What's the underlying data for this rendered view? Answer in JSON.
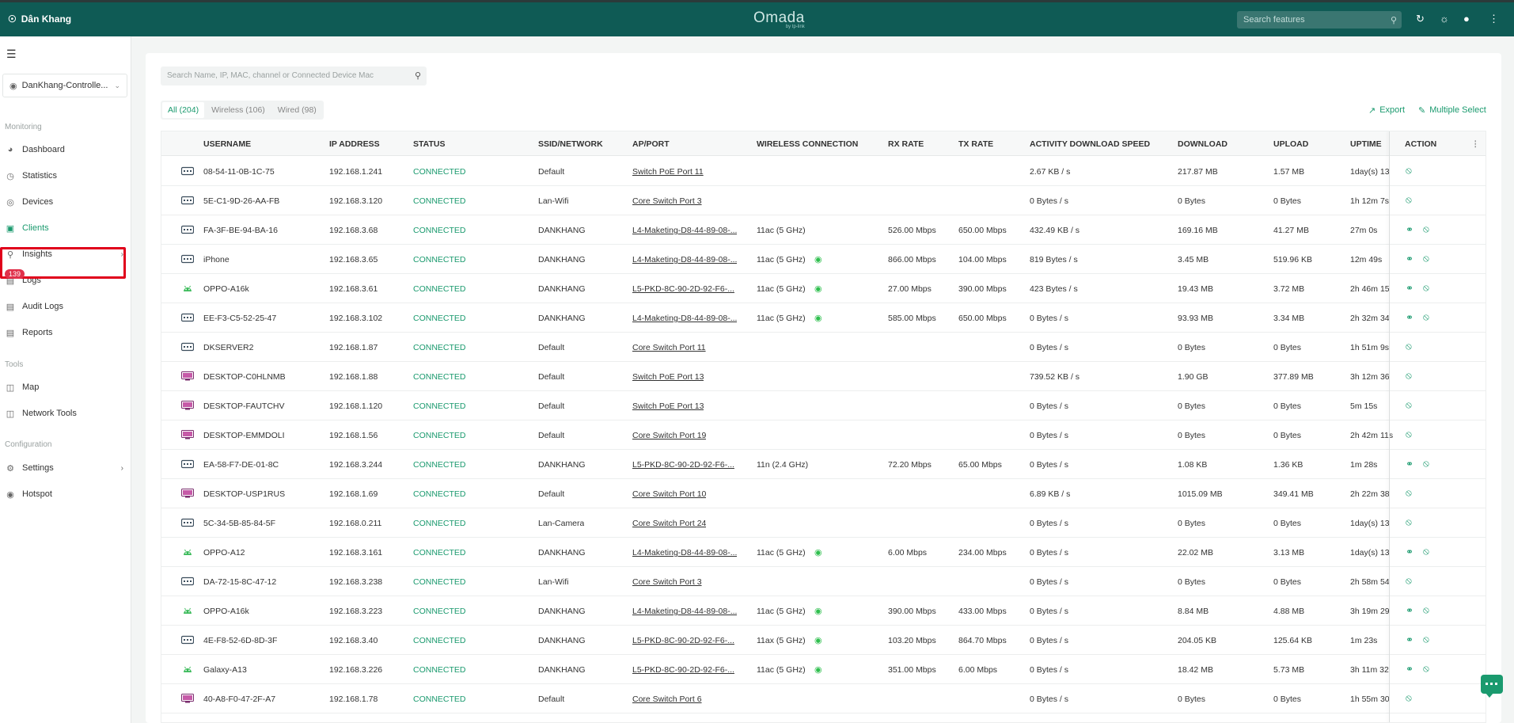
{
  "topbar": {
    "site_name": "Dân Khang",
    "logo_name": "Omada",
    "logo_sub": "by tp-link",
    "search_placeholder": "Search features"
  },
  "sidebar": {
    "site_select": "DanKhang-Controlle...",
    "sections": {
      "monitoring": "Monitoring",
      "tools": "Tools",
      "configuration": "Configuration"
    },
    "items": [
      {
        "label": "Dashboard"
      },
      {
        "label": "Statistics"
      },
      {
        "label": "Devices"
      },
      {
        "label": "Clients"
      },
      {
        "label": "Insights"
      },
      {
        "label": "Logs"
      },
      {
        "label": "Audit Logs"
      },
      {
        "label": "Reports"
      },
      {
        "label": "Map"
      },
      {
        "label": "Network Tools"
      },
      {
        "label": "Settings"
      },
      {
        "label": "Hotspot"
      }
    ],
    "logs_badge": "139"
  },
  "toolbar": {
    "search_placeholder": "Search Name, IP, MAC, channel or Connected Device Mac",
    "filters": [
      "All (204)",
      "Wireless (106)",
      "Wired (98)"
    ],
    "export_label": "Export",
    "multiple_select_label": "Multiple Select"
  },
  "table": {
    "headers": [
      "USERNAME",
      "IP ADDRESS",
      "STATUS",
      "SSID/NETWORK",
      "AP/PORT",
      "WIRELESS CONNECTION",
      "RX RATE",
      "TX RATE",
      "ACTIVITY DOWNLOAD SPEED",
      "DOWNLOAD",
      "UPLOAD",
      "UPTIME",
      "ACTION"
    ],
    "rows": [
      {
        "type": "wired",
        "name": "08-54-11-0B-1C-75",
        "ip": "192.168.1.241",
        "status": "CONNECTED",
        "ssid": "Default",
        "port": "Switch PoE Port 11",
        "wireless": "",
        "rx": "",
        "tx": "",
        "activity": "2.67 KB / s",
        "down": "217.87 MB",
        "up": "1.57 MB",
        "uptime": "1day(s) 13",
        "wifi": false
      },
      {
        "type": "wired",
        "name": "5E-C1-9D-26-AA-FB",
        "ip": "192.168.3.120",
        "status": "CONNECTED",
        "ssid": "Lan-Wifi",
        "port": "Core Switch Port 3",
        "wireless": "",
        "rx": "",
        "tx": "",
        "activity": "0 Bytes / s",
        "down": "0 Bytes",
        "up": "0 Bytes",
        "uptime": "1h 12m 7s",
        "wifi": false
      },
      {
        "type": "wired",
        "name": "FA-3F-BE-94-BA-16",
        "ip": "192.168.3.68",
        "status": "CONNECTED",
        "ssid": "DANKHANG",
        "port": "L4-Maketing-D8-44-89-08-...",
        "wireless": "11ac (5 GHz)",
        "rx": "526.00 Mbps",
        "tx": "650.00 Mbps",
        "activity": "432.49 KB / s",
        "down": "169.16 MB",
        "up": "41.27 MB",
        "uptime": "27m 0s",
        "wifi": true,
        "bulb": false
      },
      {
        "type": "wired",
        "name": "iPhone",
        "ip": "192.168.3.65",
        "status": "CONNECTED",
        "ssid": "DANKHANG",
        "port": "L4-Maketing-D8-44-89-08-...",
        "wireless": "11ac (5 GHz)",
        "rx": "866.00 Mbps",
        "tx": "104.00 Mbps",
        "activity": "819 Bytes / s",
        "down": "3.45 MB",
        "up": "519.96 KB",
        "uptime": "12m 49s",
        "wifi": true,
        "bulb": true
      },
      {
        "type": "android",
        "name": "OPPO-A16k",
        "ip": "192.168.3.61",
        "status": "CONNECTED",
        "ssid": "DANKHANG",
        "port": "L5-PKD-8C-90-2D-92-F6-...",
        "wireless": "11ac (5 GHz)",
        "rx": "27.00 Mbps",
        "tx": "390.00 Mbps",
        "activity": "423 Bytes / s",
        "down": "19.43 MB",
        "up": "3.72 MB",
        "uptime": "2h 46m 15",
        "wifi": true,
        "bulb": true
      },
      {
        "type": "wired",
        "name": "EE-F3-C5-52-25-47",
        "ip": "192.168.3.102",
        "status": "CONNECTED",
        "ssid": "DANKHANG",
        "port": "L4-Maketing-D8-44-89-08-...",
        "wireless": "11ac (5 GHz)",
        "rx": "585.00 Mbps",
        "tx": "650.00 Mbps",
        "activity": "0 Bytes / s",
        "down": "93.93 MB",
        "up": "3.34 MB",
        "uptime": "2h 32m 34",
        "wifi": true,
        "bulb": true
      },
      {
        "type": "wired",
        "name": "DKSERVER2",
        "ip": "192.168.1.87",
        "status": "CONNECTED",
        "ssid": "Default",
        "port": "Core Switch Port 11",
        "wireless": "",
        "rx": "",
        "tx": "",
        "activity": "0 Bytes / s",
        "down": "0 Bytes",
        "up": "0 Bytes",
        "uptime": "1h 51m 9s",
        "wifi": false
      },
      {
        "type": "desktop",
        "name": "DESKTOP-C0HLNMB",
        "ip": "192.168.1.88",
        "status": "CONNECTED",
        "ssid": "Default",
        "port": "Switch PoE Port 13",
        "wireless": "",
        "rx": "",
        "tx": "",
        "activity": "739.52 KB / s",
        "down": "1.90 GB",
        "up": "377.89 MB",
        "uptime": "3h 12m 36",
        "wifi": false
      },
      {
        "type": "desktop",
        "name": "DESKTOP-FAUTCHV",
        "ip": "192.168.1.120",
        "status": "CONNECTED",
        "ssid": "Default",
        "port": "Switch PoE Port 13",
        "wireless": "",
        "rx": "",
        "tx": "",
        "activity": "0 Bytes / s",
        "down": "0 Bytes",
        "up": "0 Bytes",
        "uptime": "5m 15s",
        "wifi": false
      },
      {
        "type": "desktop",
        "name": "DESKTOP-EMMDOLI",
        "ip": "192.168.1.56",
        "status": "CONNECTED",
        "ssid": "Default",
        "port": "Core Switch Port 19",
        "wireless": "",
        "rx": "",
        "tx": "",
        "activity": "0 Bytes / s",
        "down": "0 Bytes",
        "up": "0 Bytes",
        "uptime": "2h 42m 11s",
        "wifi": false
      },
      {
        "type": "wired",
        "name": "EA-58-F7-DE-01-8C",
        "ip": "192.168.3.244",
        "status": "CONNECTED",
        "ssid": "DANKHANG",
        "port": "L5-PKD-8C-90-2D-92-F6-...",
        "wireless": "11n (2.4 GHz)",
        "rx": "72.20 Mbps",
        "tx": "65.00 Mbps",
        "activity": "0 Bytes / s",
        "down": "1.08 KB",
        "up": "1.36 KB",
        "uptime": "1m 28s",
        "wifi": true,
        "bulb": false
      },
      {
        "type": "desktop",
        "name": "DESKTOP-USP1RUS",
        "ip": "192.168.1.69",
        "status": "CONNECTED",
        "ssid": "Default",
        "port": "Core Switch Port 10",
        "wireless": "",
        "rx": "",
        "tx": "",
        "activity": "6.89 KB / s",
        "down": "1015.09 MB",
        "up": "349.41 MB",
        "uptime": "2h 22m 38",
        "wifi": false
      },
      {
        "type": "wired",
        "name": "5C-34-5B-85-84-5F",
        "ip": "192.168.0.211",
        "status": "CONNECTED",
        "ssid": "Lan-Camera",
        "port": "Core Switch Port 24",
        "wireless": "",
        "rx": "",
        "tx": "",
        "activity": "0 Bytes / s",
        "down": "0 Bytes",
        "up": "0 Bytes",
        "uptime": "1day(s) 13",
        "wifi": false
      },
      {
        "type": "android",
        "name": "OPPO-A12",
        "ip": "192.168.3.161",
        "status": "CONNECTED",
        "ssid": "DANKHANG",
        "port": "L4-Maketing-D8-44-89-08-...",
        "wireless": "11ac (5 GHz)",
        "rx": "6.00 Mbps",
        "tx": "234.00 Mbps",
        "activity": "0 Bytes / s",
        "down": "22.02 MB",
        "up": "3.13 MB",
        "uptime": "1day(s) 13",
        "wifi": true,
        "bulb": true
      },
      {
        "type": "wired",
        "name": "DA-72-15-8C-47-12",
        "ip": "192.168.3.238",
        "status": "CONNECTED",
        "ssid": "Lan-Wifi",
        "port": "Core Switch Port 3",
        "wireless": "",
        "rx": "",
        "tx": "",
        "activity": "0 Bytes / s",
        "down": "0 Bytes",
        "up": "0 Bytes",
        "uptime": "2h 58m 54",
        "wifi": false
      },
      {
        "type": "android",
        "name": "OPPO-A16k",
        "ip": "192.168.3.223",
        "status": "CONNECTED",
        "ssid": "DANKHANG",
        "port": "L4-Maketing-D8-44-89-08-...",
        "wireless": "11ac (5 GHz)",
        "rx": "390.00 Mbps",
        "tx": "433.00 Mbps",
        "activity": "0 Bytes / s",
        "down": "8.84 MB",
        "up": "4.88 MB",
        "uptime": "3h 19m 29",
        "wifi": true,
        "bulb": true
      },
      {
        "type": "wired",
        "name": "4E-F8-52-6D-8D-3F",
        "ip": "192.168.3.40",
        "status": "CONNECTED",
        "ssid": "DANKHANG",
        "port": "L5-PKD-8C-90-2D-92-F6-...",
        "wireless": "11ax (5 GHz)",
        "rx": "103.20 Mbps",
        "tx": "864.70 Mbps",
        "activity": "0 Bytes / s",
        "down": "204.05 KB",
        "up": "125.64 KB",
        "uptime": "1m 23s",
        "wifi": true,
        "bulb": true
      },
      {
        "type": "android",
        "name": "Galaxy-A13",
        "ip": "192.168.3.226",
        "status": "CONNECTED",
        "ssid": "DANKHANG",
        "port": "L5-PKD-8C-90-2D-92-F6-...",
        "wireless": "11ac (5 GHz)",
        "rx": "351.00 Mbps",
        "tx": "6.00 Mbps",
        "activity": "0 Bytes / s",
        "down": "18.42 MB",
        "up": "5.73 MB",
        "uptime": "3h 11m 32",
        "wifi": true,
        "bulb": true
      },
      {
        "type": "desktop",
        "name": "40-A8-F0-47-2F-A7",
        "ip": "192.168.1.78",
        "status": "CONNECTED",
        "ssid": "Default",
        "port": "Core Switch Port 6",
        "wireless": "",
        "rx": "",
        "tx": "",
        "activity": "0 Bytes / s",
        "down": "0 Bytes",
        "up": "0 Bytes",
        "uptime": "1h 55m 30",
        "wifi": false
      }
    ]
  },
  "colors": {
    "brand": "#0f5b55",
    "accent": "#1a9a6e",
    "highlight_border": "#e0001b",
    "badge": "#e0314b"
  }
}
